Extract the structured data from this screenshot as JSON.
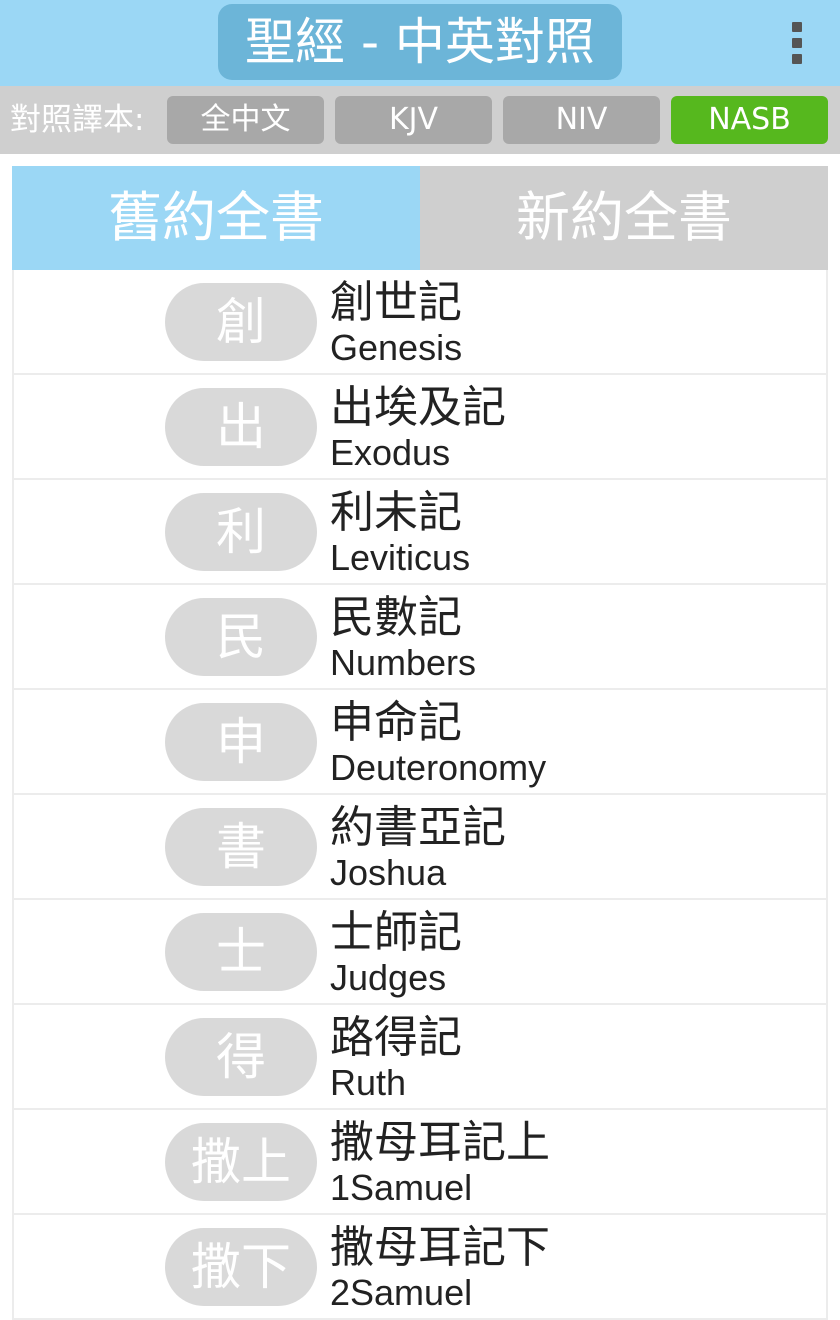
{
  "header": {
    "title": "聖經 - 中英對照",
    "menu_icon": "overflow-menu-icon"
  },
  "translation_bar": {
    "label": "對照譯本:",
    "options": [
      "全中文",
      "KJV",
      "NIV",
      "NASB"
    ],
    "selected": "NASB",
    "selected_color": "#56b81e"
  },
  "tabs": {
    "old_testament": "舊約全書",
    "new_testament": "新約全書",
    "active": "舊約全書"
  },
  "books": [
    {
      "abbr": "創",
      "name_zh": "創世記",
      "name_en": "Genesis"
    },
    {
      "abbr": "出",
      "name_zh": "出埃及記",
      "name_en": "Exodus"
    },
    {
      "abbr": "利",
      "name_zh": "利未記",
      "name_en": "Leviticus"
    },
    {
      "abbr": "民",
      "name_zh": "民數記",
      "name_en": "Numbers"
    },
    {
      "abbr": "申",
      "name_zh": "申命記",
      "name_en": "Deuteronomy"
    },
    {
      "abbr": "書",
      "name_zh": "約書亞記",
      "name_en": "Joshua"
    },
    {
      "abbr": "士",
      "name_zh": "士師記",
      "name_en": "Judges"
    },
    {
      "abbr": "得",
      "name_zh": "路得記",
      "name_en": "Ruth"
    },
    {
      "abbr": "撒上",
      "name_zh": "撒母耳記上",
      "name_en": "1Samuel"
    },
    {
      "abbr": "撒下",
      "name_zh": "撒母耳記下",
      "name_en": "2Samuel"
    }
  ]
}
